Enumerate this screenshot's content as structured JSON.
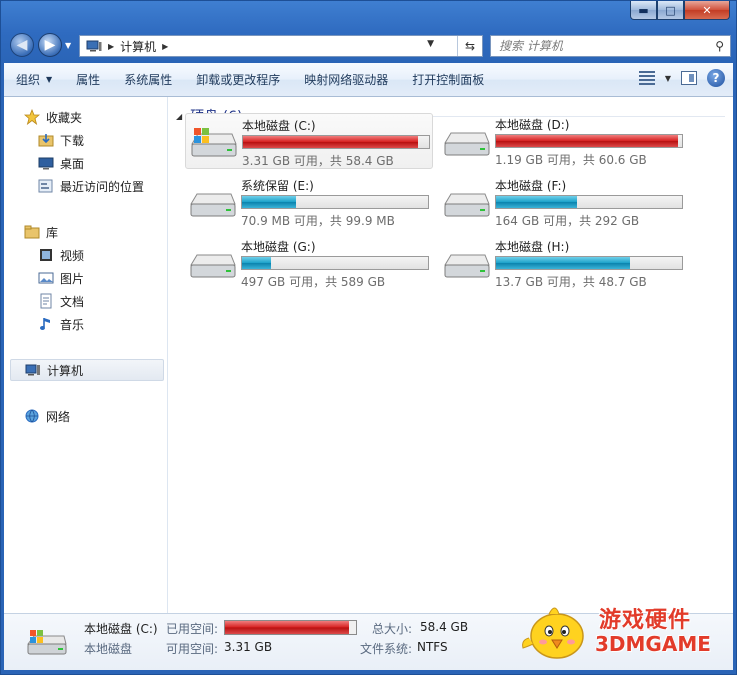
{
  "window": {
    "minimize": "▬",
    "maximize": "□",
    "close": "✕"
  },
  "address": {
    "path": "计算机",
    "search_placeholder": "搜索 计算机"
  },
  "toolbar": {
    "organize": "组织",
    "properties": "属性",
    "system_properties": "系统属性",
    "uninstall": "卸载或更改程序",
    "map_drive": "映射网络驱动器",
    "control_panel": "打开控制面板"
  },
  "sidebar": {
    "items": [
      {
        "label": "收藏夹",
        "icon": "star-icon"
      },
      {
        "label": "下载",
        "icon": "download-folder-icon"
      },
      {
        "label": "桌面",
        "icon": "desktop-icon"
      },
      {
        "label": "最近访问的位置",
        "icon": "recent-places-icon"
      },
      {
        "label": "库",
        "icon": "library-icon"
      },
      {
        "label": "视频",
        "icon": "video-icon"
      },
      {
        "label": "图片",
        "icon": "pictures-icon"
      },
      {
        "label": "文档",
        "icon": "documents-icon"
      },
      {
        "label": "音乐",
        "icon": "music-icon"
      },
      {
        "label": "计算机",
        "icon": "computer-icon"
      },
      {
        "label": "网络",
        "icon": "network-icon"
      }
    ]
  },
  "main": {
    "group_title": "硬盘 (6)",
    "drives": [
      {
        "name": "本地磁盘 (C:)",
        "free_text": "3.31 GB 可用，共 58.4 GB",
        "used_fraction": 0.943,
        "bar_color": "red"
      },
      {
        "name": "本地磁盘 (D:)",
        "free_text": "1.19 GB 可用，共 60.6 GB",
        "used_fraction": 0.98,
        "bar_color": "red"
      },
      {
        "name": "系统保留 (E:)",
        "free_text": "70.9 MB 可用，共 99.9 MB",
        "used_fraction": 0.29,
        "bar_color": "blue"
      },
      {
        "name": "本地磁盘 (F:)",
        "free_text": "164 GB 可用，共 292 GB",
        "used_fraction": 0.438,
        "bar_color": "blue"
      },
      {
        "name": "本地磁盘 (G:)",
        "free_text": "497 GB 可用，共 589 GB",
        "used_fraction": 0.156,
        "bar_color": "blue"
      },
      {
        "name": "本地磁盘 (H:)",
        "free_text": "13.7 GB 可用，共 48.7 GB",
        "used_fraction": 0.719,
        "bar_color": "blue"
      }
    ]
  },
  "details": {
    "name": "本地磁盘 (C:)",
    "type": "本地磁盘",
    "used_label": "已用空间:",
    "free_label": "可用空间:",
    "free_value": "3.31 GB",
    "total_label": "总大小:",
    "total_value": "58.4 GB",
    "fs_label": "文件系统:",
    "fs_value": "NTFS",
    "used_fraction": 0.943
  },
  "watermark": {
    "line1": "游戏硬件",
    "line2": "3DMGAME"
  }
}
